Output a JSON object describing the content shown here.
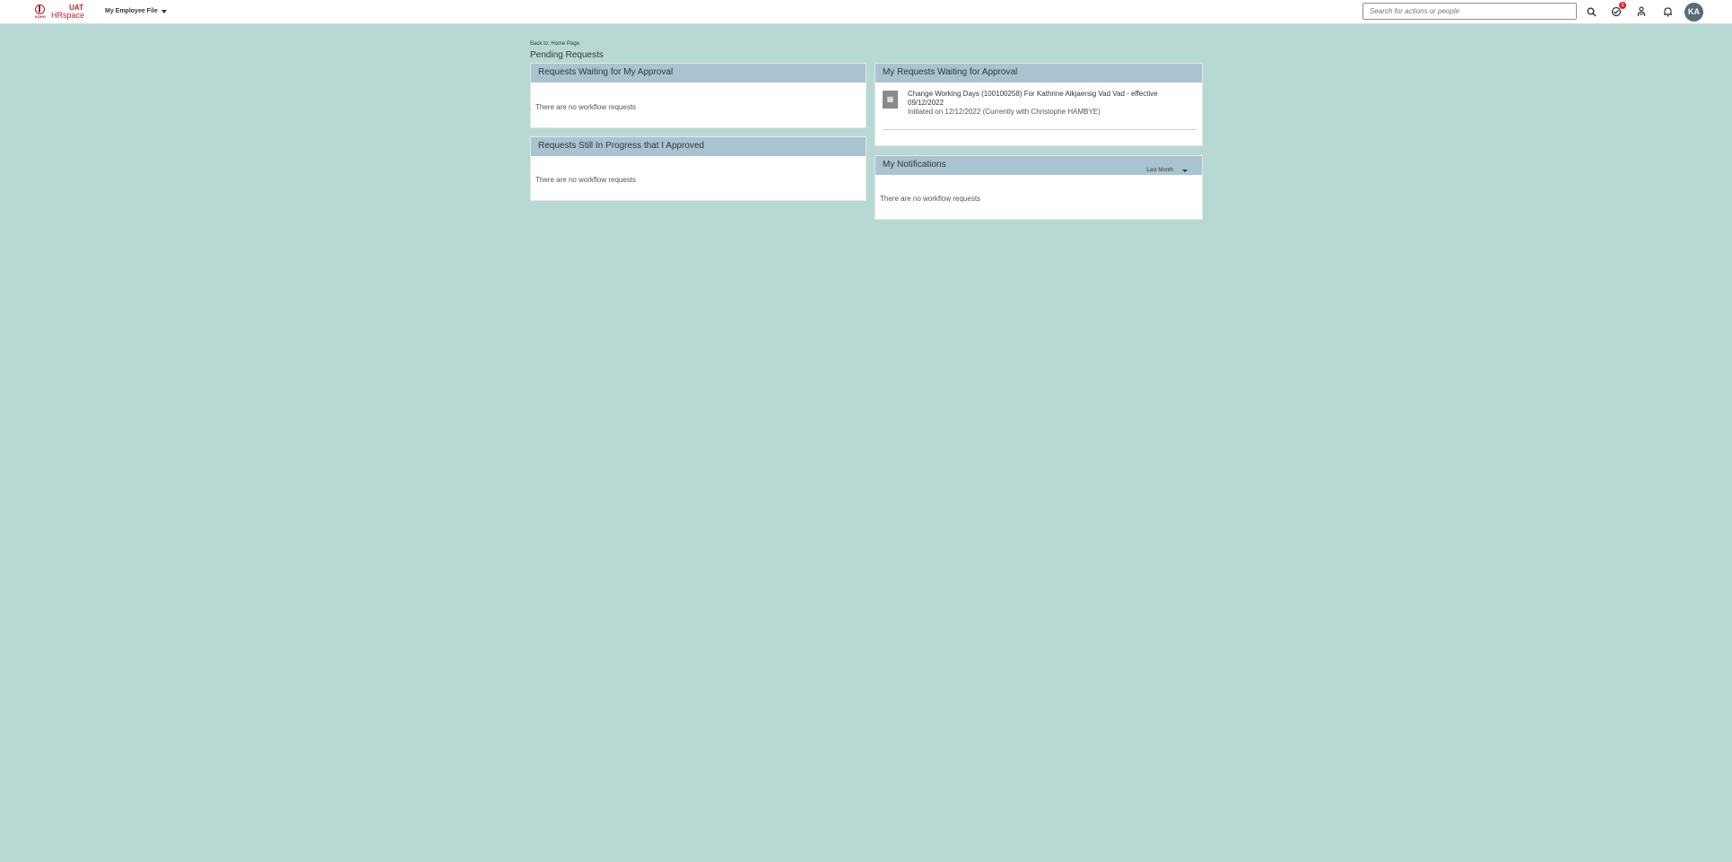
{
  "logo": {
    "small_text": "KOHO",
    "line1": "UAT",
    "line2": "HRspace"
  },
  "header": {
    "menu_title": "My Employee File",
    "search_placeholder": "Search for actions or people",
    "approvals_badge": "1",
    "avatar_initials": "KA"
  },
  "page": {
    "back_link": "Back to: Home Page",
    "title": "Pending Requests"
  },
  "panels": {
    "waiting_my_approval": {
      "title": "Requests Waiting for My Approval",
      "empty_text": "There are no workflow requests"
    },
    "in_progress_approved": {
      "title": "Requests Still In Progress that I Approved",
      "empty_text": "There are no workflow requests"
    },
    "my_requests": {
      "title": "My Requests Waiting for Approval",
      "item": {
        "title_line1": "Change Working Days (100100258) For Kathrine Alkjaersig Vad Vad - effective",
        "title_line2": "09/12/2022",
        "subtitle": "Initiated on 12/12/2022 (Currently with Christophe HAMBYE)"
      }
    },
    "notifications": {
      "title": "My Notifications",
      "filter_value": "Last Month",
      "empty_text": "There are no workflow requests"
    }
  },
  "colors": {
    "background": "#b8d9d3",
    "panel_header": "#a9c4d0",
    "brand_red": "#c8202a"
  }
}
